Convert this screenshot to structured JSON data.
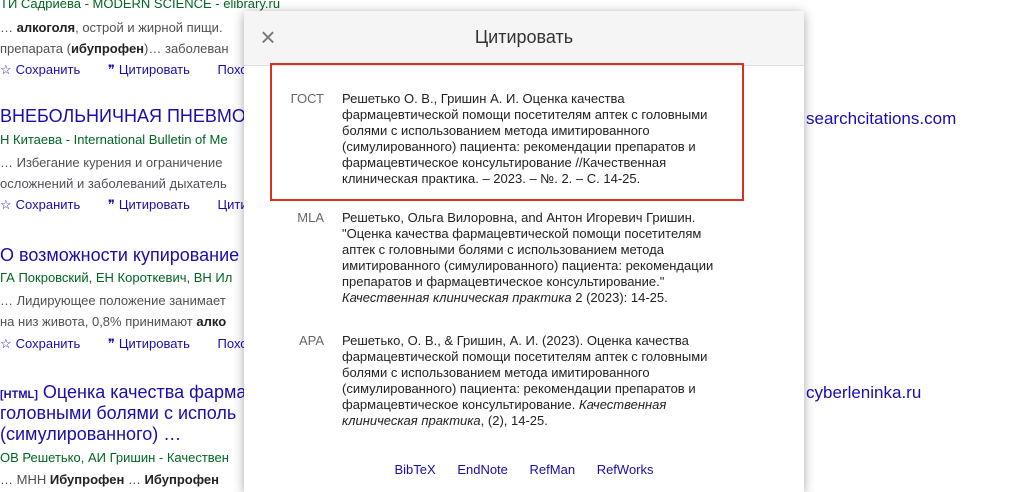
{
  "background": {
    "results": [
      {
        "source": "ТИ Садриева - MODERN SCIENCE - elibrary.ru",
        "snippet1_a": "… ",
        "snippet1_b": "алкоголя",
        "snippet1_c": ", острой и жирной пищи. ",
        "snippet2_a": "препарата (",
        "snippet2_b": "ибупрофен",
        "snippet2_c": ")… заболеван",
        "save": "Сохранить",
        "cite": "Цитировать",
        "similar": "Похо"
      },
      {
        "title": "ВНЕБОЛЬНИЧНАЯ ПНЕВМО",
        "source": "Н Китаева - International Bulletin of Me",
        "snippet1": "… Избегание курения и ограничение",
        "snippet2": "осложнений и заболеваний дыхатель",
        "save": "Сохранить",
        "cite": "Цитировать",
        "similar": "Цити"
      },
      {
        "title": "О возможности купирование",
        "source": "ГА Покровский, ЕН Короткевич, ВН Ил",
        "snippet1": "… Лидирующее положение занимает",
        "snippet2_a": "на низ живота, 0,8% принимают ",
        "snippet2_b": "алко",
        "save": "Сохранить",
        "cite": "Цитировать",
        "similar": "Похо"
      },
      {
        "tag": "[HTML]",
        "title_line1": "Оценка качества фарма",
        "title_line2": "головными болями с исполь",
        "title_line3": "(симулированного) …",
        "source": "ОВ Решетько, АИ Гришин - Качествен",
        "snippet1_a": "… МНН ",
        "snippet1_b": "Ибупрофен",
        "snippet1_c": " … ",
        "snippet1_d": "Ибупрофен"
      }
    ],
    "side_links": [
      "searchcitations.com",
      "cyberleninka.ru"
    ]
  },
  "dialog": {
    "title": "Цитировать",
    "close_icon": "close-icon",
    "citations": [
      {
        "label": "ГОСТ",
        "lines": [
          "Решетько О. В., Гришин А. И. Оценка качества",
          "фармацевтической помощи посетителям аптек с головными",
          "болями с использованием метода имитированного",
          "(симулированного) пациента: рекомендации препаратов и",
          "фармацевтическое консультирование //Качественная",
          "клиническая практика. – 2023. – №. 2. – С. 14-25."
        ]
      },
      {
        "label": "MLA",
        "lines": [
          "Решетько, Ольга Вилоровна, and Антон Игоревич Гришин.",
          "\"Оценка качества фармацевтической помощи посетителям",
          "аптек с головными болями с использованием метода",
          "имитированного (симулированного) пациента: рекомендации",
          "препаратов и фармацевтическое консультирование.\""
        ],
        "journal": "Качественная клиническая практика",
        "tail": " 2 (2023): 14-25."
      },
      {
        "label": "APA",
        "lines": [
          "Решетько, О. В., & Гришин, А. И. (2023). Оценка качества",
          "фармацевтической помощи посетителям аптек с головными",
          "болями с использованием метода имитированного",
          "(симулированного) пациента: рекомендации препаратов и"
        ],
        "line5_plain": "фармацевтическое консультирование. ",
        "line5_italic": "Качественная",
        "line6_italic": "клиническая практика",
        "line6_tail": ", (2), 14-25."
      }
    ],
    "exports": [
      "BibTeX",
      "EndNote",
      "RefMan",
      "RefWorks"
    ]
  }
}
